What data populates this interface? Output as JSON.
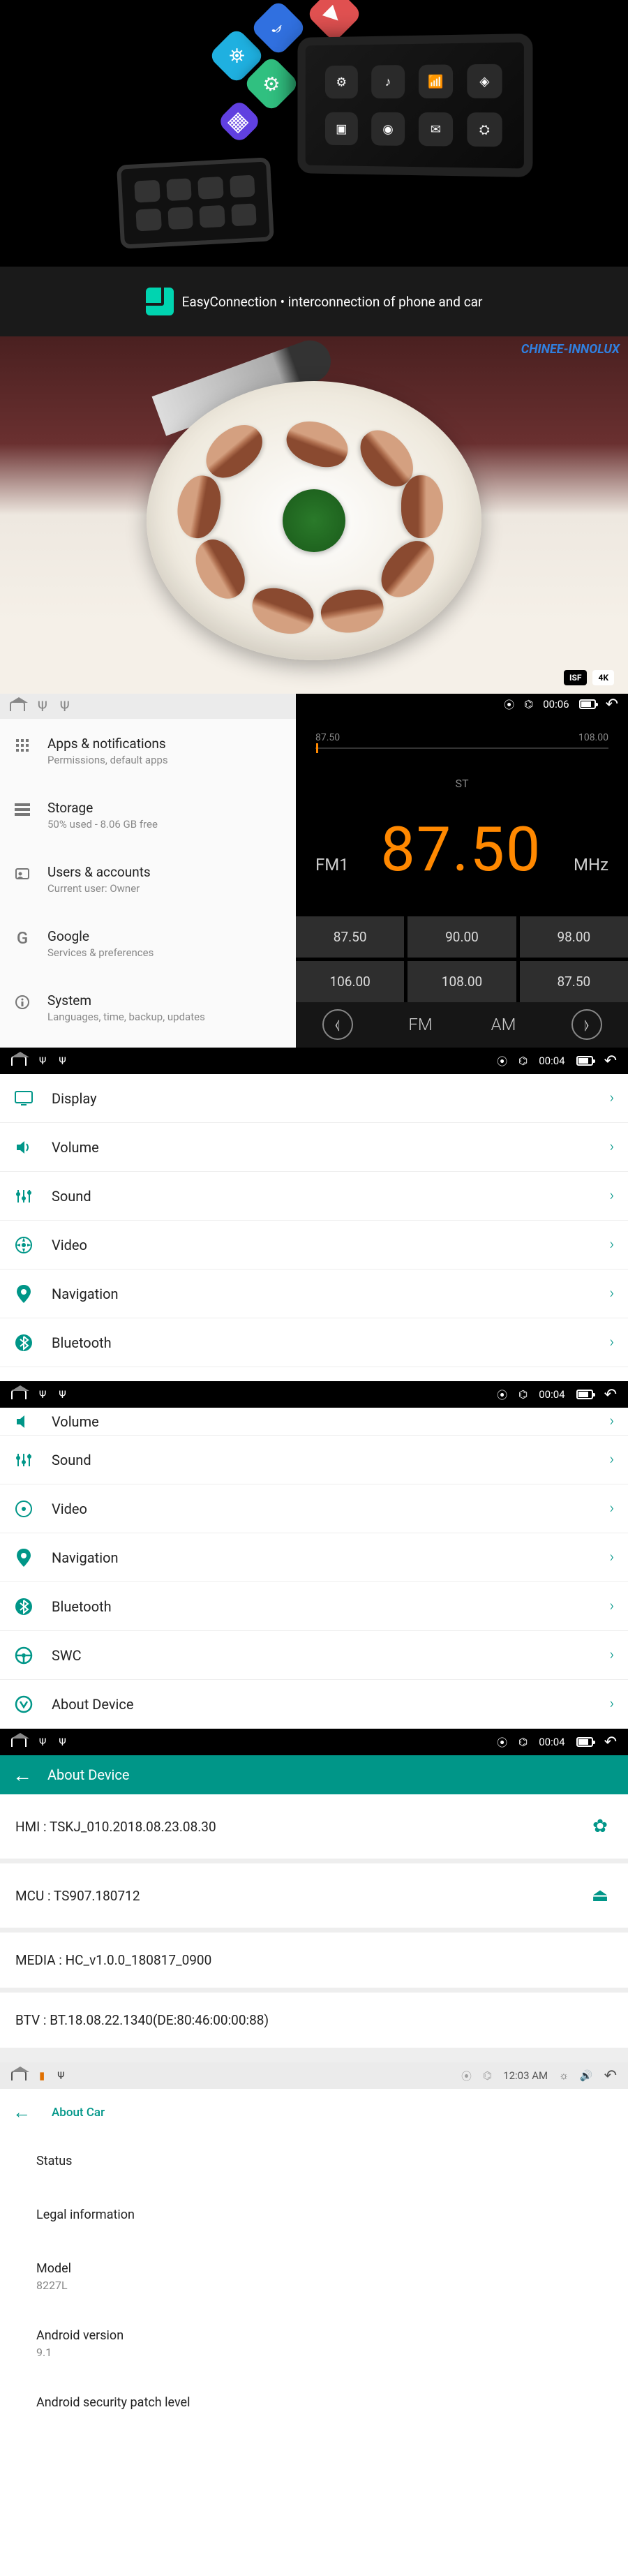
{
  "easyconnection": {
    "label": "EasyConnection • interconnection of phone and car"
  },
  "video": {
    "watermark": "CHINEE-INNOLUX",
    "badges": [
      "ISF",
      "4K"
    ]
  },
  "status": {
    "time_short": "00:06",
    "time_menu": "00:04",
    "time_car": "12:03 AM"
  },
  "settings": {
    "items": [
      {
        "title": "Apps & notifications",
        "sub": "Permissions, default apps",
        "ico": "grid"
      },
      {
        "title": "Storage",
        "sub": "50% used - 8.06 GB free",
        "ico": "storage"
      },
      {
        "title": "Users & accounts",
        "sub": "Current user: Owner",
        "ico": "user"
      },
      {
        "title": "Google",
        "sub": "Services & preferences",
        "ico": "google"
      },
      {
        "title": "System",
        "sub": "Languages, time, backup, updates",
        "ico": "info"
      }
    ]
  },
  "radio": {
    "scale_lo": "87.50",
    "scale_hi": "108.00",
    "st": "ST",
    "band": "FM1",
    "freq": "87.50",
    "unit": "MHz",
    "presets": [
      "87.50",
      "90.00",
      "98.00",
      "106.00",
      "108.00",
      "87.50"
    ],
    "fm": "FM",
    "am": "AM"
  },
  "menu1": {
    "items": [
      {
        "label": "Display",
        "ico": "display"
      },
      {
        "label": "Volume",
        "ico": "volume"
      },
      {
        "label": "Sound",
        "ico": "sound"
      },
      {
        "label": "Video",
        "ico": "video"
      },
      {
        "label": "Navigation",
        "ico": "nav"
      },
      {
        "label": "Bluetooth",
        "ico": "bt"
      }
    ]
  },
  "menu2": {
    "partial": "Volume",
    "items": [
      {
        "label": "Sound",
        "ico": "sound"
      },
      {
        "label": "Video",
        "ico": "video"
      },
      {
        "label": "Navigation",
        "ico": "nav"
      },
      {
        "label": "Bluetooth",
        "ico": "bt"
      },
      {
        "label": "SWC",
        "ico": "swc"
      },
      {
        "label": "About Device",
        "ico": "about"
      }
    ]
  },
  "about": {
    "title": "About Device",
    "rows": [
      "HMI : TSKJ_010.2018.08.23.08.30",
      "MCU : TS907.180712",
      "MEDIA : HC_v1.0.0_180817_0900",
      "BTV : BT.18.08.22.1340(DE:80:46:00:00:88)"
    ]
  },
  "car": {
    "title": "About Car",
    "rows": [
      {
        "t": "Status",
        "s": ""
      },
      {
        "t": "Legal information",
        "s": ""
      },
      {
        "t": "Model",
        "s": "8227L"
      },
      {
        "t": "Android version",
        "s": "9.1"
      },
      {
        "t": "Android security patch level",
        "s": ""
      }
    ]
  }
}
